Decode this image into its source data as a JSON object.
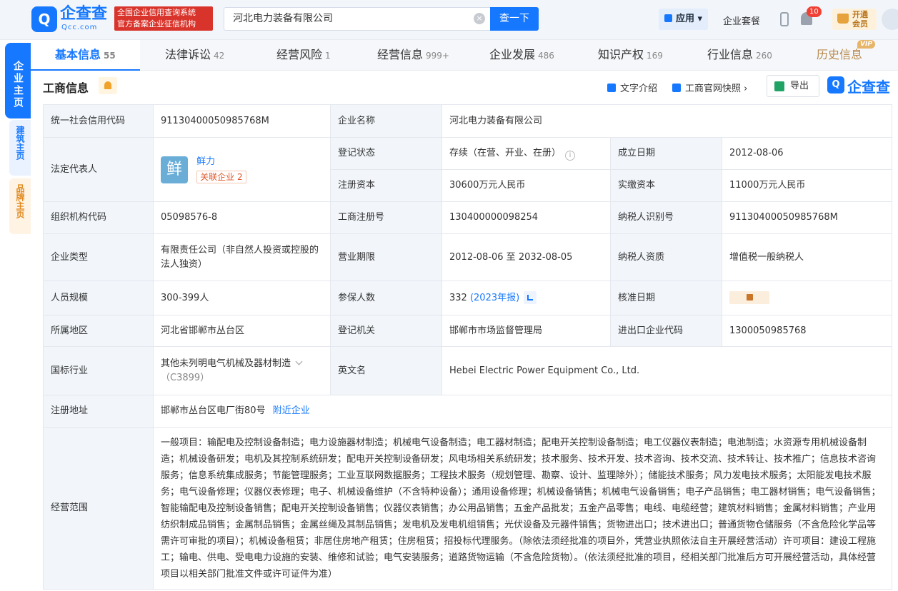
{
  "header": {
    "logo_text": "企查查",
    "logo_sub": "Qcc.com",
    "slogan_line1": "全国企业信用查询系统",
    "slogan_line2": "官方备案企业征信机构",
    "search_value": "河北电力装备有限公司",
    "search_button": "查一下",
    "apps_label": "应用",
    "suite_label": "企业套餐",
    "notification_count": "10",
    "vip_line1": "开通",
    "vip_line2": "会员"
  },
  "side_nav": {
    "main": "企业主页",
    "build": "建筑主页",
    "brand": "品牌主页"
  },
  "tabs": [
    {
      "label": "基本信息",
      "count": "55"
    },
    {
      "label": "法律诉讼",
      "count": "42"
    },
    {
      "label": "经营风险",
      "count": "1"
    },
    {
      "label": "经营信息",
      "count": "999+"
    },
    {
      "label": "企业发展",
      "count": "486"
    },
    {
      "label": "知识产权",
      "count": "169"
    },
    {
      "label": "行业信息",
      "count": "260"
    },
    {
      "label": "历史信息",
      "count": ""
    }
  ],
  "history_tag": "VIP",
  "section": {
    "title": "工商信息",
    "text_intro": "文字介绍",
    "snapshot": "工商官网快照",
    "export": "导出",
    "watermark": "企查查"
  },
  "table": {
    "credit_code_label": "统一社会信用代码",
    "credit_code": "91130400050985768M",
    "company_name_label": "企业名称",
    "company_name": "河北电力装备有限公司",
    "legal_rep_label": "法定代表人",
    "legal_rep_avatar": "鲜",
    "legal_rep": "鲜力",
    "related_companies": "关联企业 2",
    "reg_status_label": "登记状态",
    "reg_status": "存续（在营、开业、在册）",
    "founded_label": "成立日期",
    "founded": "2012-08-06",
    "reg_capital_label": "注册资本",
    "reg_capital": "30600万元人民币",
    "paid_capital_label": "实缴资本",
    "paid_capital": "11000万元人民币",
    "org_code_label": "组织机构代码",
    "org_code": "05098576-8",
    "biz_reg_no_label": "工商注册号",
    "biz_reg_no": "130400000098254",
    "taxpayer_id_label": "纳税人识别号",
    "taxpayer_id": "91130400050985768M",
    "company_type_label": "企业类型",
    "company_type": "有限责任公司（非自然人投资或控股的法人独资）",
    "term_label": "营业期限",
    "term": "2012-08-06 至 2032-08-05",
    "taxpayer_qual_label": "纳税人资质",
    "taxpayer_qual": "增值税一般纳税人",
    "staff_label": "人员规模",
    "staff": "300-399人",
    "insured_label": "参保人数",
    "insured": "332",
    "insured_report": "(2023年报)",
    "approved_label": "核准日期",
    "region_label": "所属地区",
    "region": "河北省邯郸市丛台区",
    "authority_label": "登记机关",
    "authority": "邯郸市市场监督管理局",
    "ie_code_label": "进出口企业代码",
    "ie_code": "1300050985768",
    "industry_label": "国标行业",
    "industry": "其他未列明电气机械及器材制造",
    "industry_code": "（C3899）",
    "english_name_label": "英文名",
    "english_name": "Hebei Electric Power Equipment Co., Ltd.",
    "address_label": "注册地址",
    "address": "邯郸市丛台区电厂街80号",
    "nearby": "附近企业",
    "scope_label": "经营范围",
    "scope": "一般项目：输配电及控制设备制造；电力设施器材制造；机械电气设备制造；电工器材制造；配电开关控制设备制造；电工仪器仪表制造；电池制造；水资源专用机械设备制造；机械设备研发；电机及其控制系统研发；配电开关控制设备研发；风电场相关系统研发；技术服务、技术开发、技术咨询、技术交流、技术转让、技术推广；信息技术咨询服务；信息系统集成服务；节能管理服务；工业互联网数据服务；工程技术服务（规划管理、勘察、设计、监理除外）；储能技术服务；风力发电技术服务；太阳能发电技术服务；电气设备修理；仪器仪表修理；电子、机械设备维护（不含特种设备）；通用设备修理；机械设备销售；机械电气设备销售；电子产品销售；电工器材销售；电气设备销售；智能输配电及控制设备销售；配电开关控制设备销售；仪器仪表销售；办公用品销售；五金产品批发；五金产品零售；电线、电缆经营；建筑材料销售；金属材料销售；产业用纺织制成品销售；金属制品销售；金属丝绳及其制品销售；发电机及发电机组销售；光伏设备及元器件销售；货物进出口；技术进出口；普通货物仓储服务（不含危险化学品等需许可审批的项目）；机械设备租赁；非居住房地产租赁；住房租赁；招投标代理服务。（除依法须经批准的项目外，凭营业执照依法自主开展经营活动）许可项目：建设工程施工；输电、供电、受电电力设施的安装、维修和试验；电气安装服务；道路货物运输（不含危险货物）。（依法须经批准的项目，经相关部门批准后方可开展经营活动，具体经营项目以相关部门批准文件或许可证件为准）"
  }
}
